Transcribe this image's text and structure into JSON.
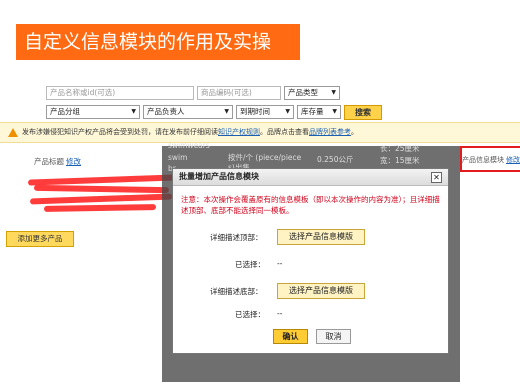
{
  "title": "自定义信息模块的作用及实操",
  "search": {
    "product_name_placeholder": "产品名称或id(可选)",
    "product_code_placeholder": "商品编码(可选)",
    "product_type": "产品类型",
    "product_group": "产品分组",
    "product_owner": "产品负责人",
    "expiry": "到期时间",
    "stock": "库存量",
    "search_label": "搜索"
  },
  "notice": {
    "text": "发布涉嫌侵犯知识产权产品将会受到处罚，请在发布前仔细阅读",
    "link1": "知识产权规则",
    "text2": "。品牌点击查看",
    "link2": "品牌列表参考",
    "end": "。"
  },
  "table": {
    "col_title": "产品标题",
    "edit_label": "修改",
    "module_col": "产品信息模块",
    "module_edit": "修改",
    "background": {
      "swimwears": "swimwears",
      "swim": "swim",
      "br": "br",
      "price_unit": "按件/个 (piece/piece",
      "price_unit2": "s)出售",
      "weight": "0.250公斤",
      "length": "长：25厘米",
      "width": "宽：15厘米"
    }
  },
  "add_more_label": "添加更多产品",
  "modal": {
    "title": "批量增加产品信息模块",
    "close_glyph": "✕",
    "note": "注意：本次操作会覆盖原有的信息模板（即以本次操作的内容为准）；且详细描述顶部、底部不能选择同一模板。",
    "top_label": "详细描述顶部：",
    "top_button": "选择产品信息模版",
    "selected_label": "已选择：",
    "selected_value": "--",
    "bottom_label": "详细描述底部：",
    "bottom_button": "选择产品信息模版",
    "ok_label": "确认",
    "cancel_label": "取消"
  }
}
